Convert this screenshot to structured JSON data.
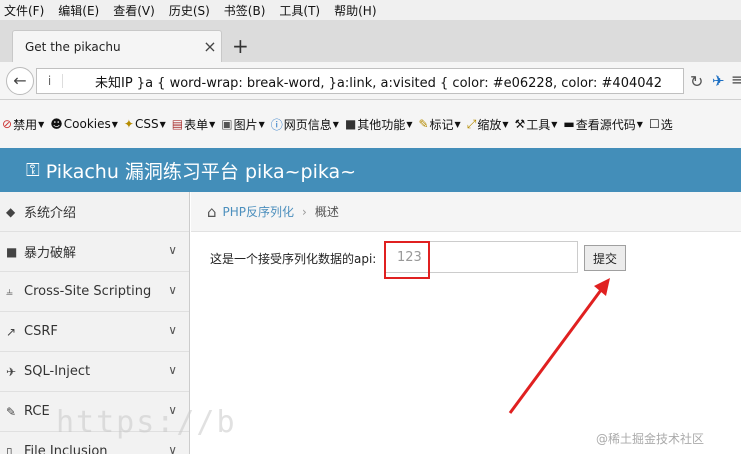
{
  "menubar": [
    "文件(F)",
    "编辑(E)",
    "查看(V)",
    "历史(S)",
    "书签(B)",
    "工具(T)",
    "帮助(H)"
  ],
  "tab": {
    "title": "Get the pikachu",
    "close": "×",
    "new_tab": "+"
  },
  "nav": {
    "url_text": "未知IP   }a { word-wrap: break-word, }a:link, a:visited { color: #e06228, color: #404042",
    "info_icon": "i"
  },
  "bookmarks": [
    {
      "label": "禁用",
      "icon": "no-entry-icon"
    },
    {
      "label": "Cookies",
      "icon": "user-icon"
    },
    {
      "label": "CSS",
      "icon": "wand-icon"
    },
    {
      "label": "表单",
      "icon": "form-icon"
    },
    {
      "label": "图片",
      "icon": "image-icon"
    },
    {
      "label": "网页信息",
      "icon": "info-icon"
    },
    {
      "label": "其他功能",
      "icon": "folder-icon"
    },
    {
      "label": "标记",
      "icon": "pencil-icon"
    },
    {
      "label": "缩放",
      "icon": "resize-icon"
    },
    {
      "label": "工具",
      "icon": "tools-icon"
    },
    {
      "label": "查看源代码",
      "icon": "source-icon"
    },
    {
      "label": "选",
      "icon": "select-icon"
    }
  ],
  "site": {
    "title": "Pikachu 漏洞练习平台 pika~pika~"
  },
  "sidebar": [
    {
      "label": "系统介绍",
      "icon": "tag-icon",
      "expandable": false
    },
    {
      "label": "暴力破解",
      "icon": "lock-icon",
      "expandable": true
    },
    {
      "label": "Cross-Site Scripting",
      "icon": "sitemap-icon",
      "expandable": true
    },
    {
      "label": "CSRF",
      "icon": "external-icon",
      "expandable": true
    },
    {
      "label": "SQL-Inject",
      "icon": "plane-icon",
      "expandable": true
    },
    {
      "label": "RCE",
      "icon": "pen-icon",
      "expandable": true
    },
    {
      "label": "File Inclusion",
      "icon": "file-icon",
      "expandable": true
    }
  ],
  "breadcrumb": {
    "parent": "PHP反序列化",
    "separator": "›",
    "current": "概述"
  },
  "form": {
    "label": "这是一个接受序列化数据的api:",
    "input_value": "123",
    "submit_label": "提交"
  },
  "watermark": {
    "left": "https://b",
    "right": "@稀土掘金技术社区"
  },
  "colors": {
    "header_bg": "#438eb9",
    "annotation": "#e02020"
  }
}
